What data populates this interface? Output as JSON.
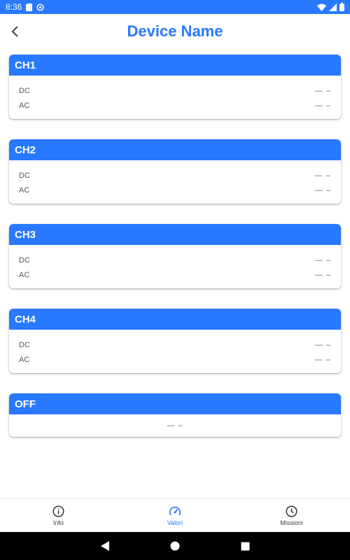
{
  "status_bar": {
    "time": "8:36"
  },
  "app_bar": {
    "title": "Device Name",
    "back_icon": "chevron-left-icon"
  },
  "cards": [
    {
      "title": "CH1",
      "rows": [
        {
          "label": "DC",
          "value": "— –"
        },
        {
          "label": "AC",
          "value": "— –"
        }
      ]
    },
    {
      "title": "CH2",
      "rows": [
        {
          "label": "DC",
          "value": "— –"
        },
        {
          "label": "AC",
          "value": "— –"
        }
      ]
    },
    {
      "title": "CH3",
      "rows": [
        {
          "label": "DC",
          "value": "— –"
        },
        {
          "label": "AC",
          "value": "— –"
        }
      ]
    },
    {
      "title": "CH4",
      "rows": [
        {
          "label": "DC",
          "value": "— –"
        },
        {
          "label": "AC",
          "value": "— –"
        }
      ]
    }
  ],
  "off_card": {
    "title": "OFF",
    "value": "— –"
  },
  "bottom_nav": {
    "items": [
      {
        "label": "Info",
        "icon": "info-icon"
      },
      {
        "label": "Valori",
        "icon": "gauge-icon",
        "active": true
      },
      {
        "label": "Missioni",
        "icon": "clock-icon"
      }
    ]
  },
  "colors": {
    "accent": "#2979ff",
    "nav_bar": "#000000"
  }
}
